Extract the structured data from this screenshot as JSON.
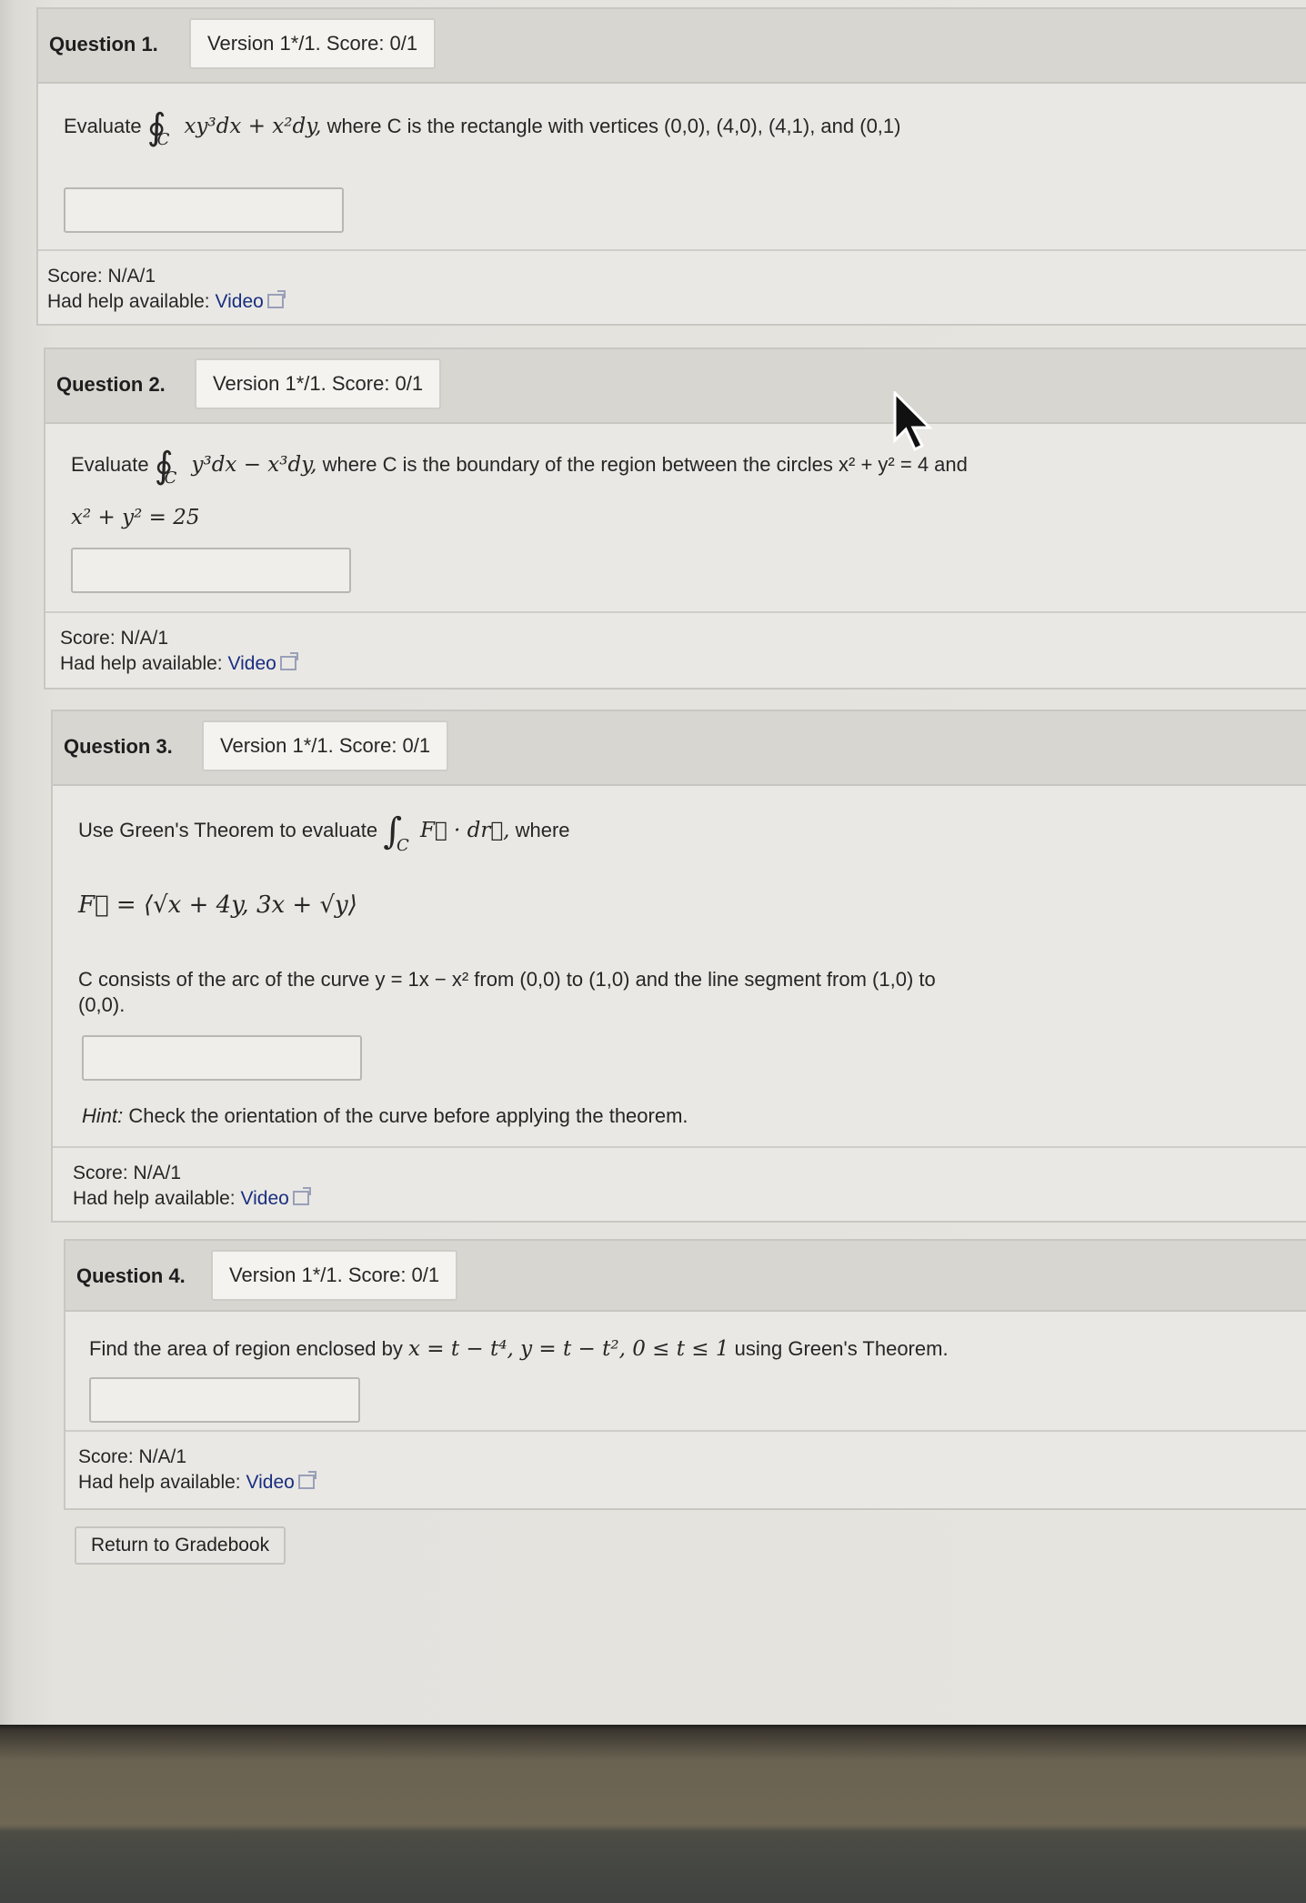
{
  "questions": [
    {
      "title": "Question 1.",
      "version": "Version 1*/1. Score: 0/1",
      "prompt_prefix": "Evaluate",
      "integral_symbol": "∮",
      "subscript": "C",
      "expression": "xy³dx + x²dy,",
      "prompt_suffix": "where C is the rectangle with vertices (0,0), (4,0), (4,1), and (0,1)",
      "score": "Score: N/A/1",
      "help_label": "Had help available:",
      "help_link": "Video"
    },
    {
      "title": "Question 2.",
      "version": "Version 1*/1. Score: 0/1",
      "prompt_prefix": "Evaluate",
      "integral_symbol": "∮",
      "subscript": "C",
      "expression": "y³dx − x³dy,",
      "prompt_suffix": "where C is the boundary of the region between the circles x² + y² = 4 and",
      "line2": "x² + y² = 25",
      "score": "Score: N/A/1",
      "help_label": "Had help available:",
      "help_link": "Video"
    },
    {
      "title": "Question 3.",
      "version": "Version 1*/1. Score: 0/1",
      "prompt_prefix": "Use Green's Theorem to evaluate",
      "integral_symbol": "∫",
      "subscript": "C",
      "expression": "F⃗ · dr⃗,",
      "prompt_suffix": "where",
      "field": "F⃗ = ⟨√x + 4y, 3x + √y⟩",
      "curve_text_1": "C consists of the arc of the curve y = 1x − x² from (0,0) to (1,0) and the line segment from (1,0) to",
      "curve_text_2": "(0,0).",
      "hint_label": "Hint:",
      "hint_text": "Check the orientation of the curve before applying the theorem.",
      "score": "Score: N/A/1",
      "help_label": "Had help available:",
      "help_link": "Video"
    },
    {
      "title": "Question 4.",
      "version": "Version 1*/1. Score: 0/1",
      "prompt_prefix": "Find the area of region enclosed by",
      "expression": "x = t − t⁴,  y = t − t²,  0 ≤ t ≤ 1",
      "prompt_suffix": "using Green's Theorem.",
      "score": "Score: N/A/1",
      "help_label": "Had help available:",
      "help_link": "Video"
    }
  ],
  "return_button": "Return to Gradebook"
}
